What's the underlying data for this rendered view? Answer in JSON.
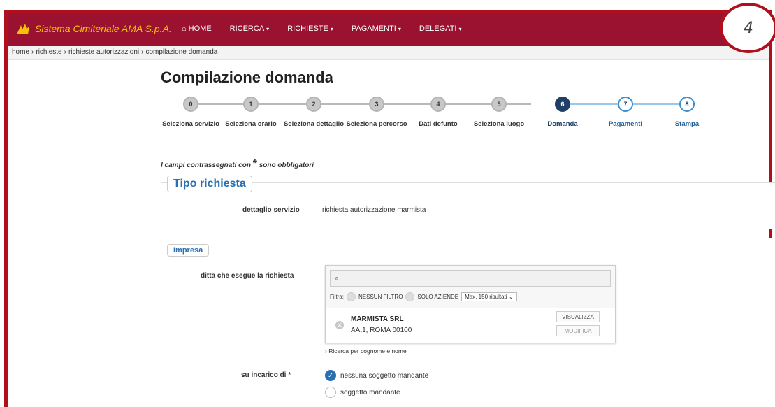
{
  "navbar": {
    "brand": "Sistema Cimiteriale AMA S.p.A.",
    "items": [
      {
        "label": "HOME",
        "icon": "home-icon"
      },
      {
        "label": "RICERCA",
        "caret": "▾"
      },
      {
        "label": "RICHIESTE",
        "caret": "▾"
      },
      {
        "label": "PAGAMENTI",
        "caret": "▾"
      },
      {
        "label": "DELEGATI",
        "caret": "▾"
      }
    ],
    "accent_color": "#9b1230",
    "brand_color": "#f3c200"
  },
  "badge": "4",
  "breadcrumb": [
    "home",
    "richieste",
    "richieste autorizzazioni",
    "compilazione domanda"
  ],
  "page_title": "Compilazione domanda",
  "stepper": {
    "steps": [
      {
        "num": "0",
        "label": "Seleziona servizio",
        "state": "past"
      },
      {
        "num": "1",
        "label": "Seleziona orario",
        "state": "past"
      },
      {
        "num": "2",
        "label": "Seleziona dettaglio",
        "state": "past"
      },
      {
        "num": "3",
        "label": "Seleziona percorso",
        "state": "past"
      },
      {
        "num": "4",
        "label": "Dati defunto",
        "state": "past"
      },
      {
        "num": "5",
        "label": "Seleziona luogo",
        "state": "past"
      },
      {
        "num": "6",
        "label": "Domanda",
        "state": "active"
      },
      {
        "num": "7",
        "label": "Pagamenti",
        "state": "future"
      },
      {
        "num": "8",
        "label": "Stampa",
        "state": "future"
      }
    ]
  },
  "required_note": {
    "before": "I campi contrassegnati con",
    "star": "*",
    "after": "sono obbligatori"
  },
  "tipo_richiesta": {
    "legend": "Tipo richiesta",
    "label": "dettaglio servizio",
    "value": "richiesta autorizzazione marmista"
  },
  "impresa": {
    "legend": "Impresa",
    "ditta_label": "ditta che esegue la richiesta",
    "search_placeholder": "",
    "filter": {
      "label": "Filtra:",
      "opt1": "NESSUN FILTRO",
      "opt2": "SOLO AZIENDE",
      "max": "Max. 150 risultati"
    },
    "result": {
      "name": "MARMISTA SRL",
      "address": "AA,1, ROMA 00100",
      "btn_view": "VISUALIZZA",
      "btn_edit": "MODIFICA"
    },
    "link_cognome": "Ricerca per cognome e nome",
    "incarico_label": "su incarico di *",
    "radio1": "nessuna soggetto mandante",
    "radio2": "soggetto mandante"
  }
}
